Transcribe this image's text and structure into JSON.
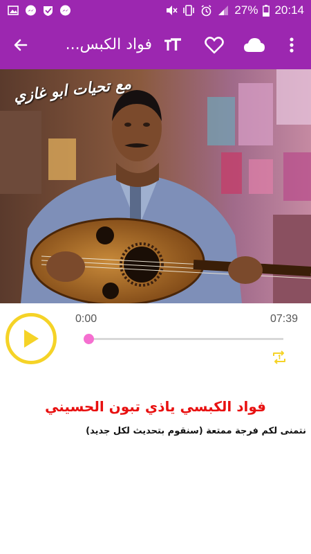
{
  "status_bar": {
    "battery": "27%",
    "time": "20:14",
    "left_icons": [
      "gallery-icon",
      "messenger-icon",
      "vpn-shield-icon",
      "messenger-icon"
    ],
    "right_icons": [
      "mute-icon",
      "vibrate-icon",
      "alarm-icon",
      "signal-icon"
    ]
  },
  "toolbar": {
    "title": "فواد الكبس...",
    "background": "#9c27b0",
    "icons": [
      "back-arrow-icon",
      "text-size-icon",
      "heart-icon",
      "cloud-icon",
      "more-vert-icon"
    ]
  },
  "cover": {
    "caption": "مع تحيات ابو غازي"
  },
  "player": {
    "elapsed": "0:00",
    "duration": "07:39",
    "progress": 0.0,
    "accent": "#f5d327",
    "seek_color": "#f56fd0"
  },
  "song": {
    "title": "فواد الكبسي ياذي تبون الحسيني",
    "description": "نتمنى لكم فرجة ممتعة (سنقوم بتحديث لكل جديد)",
    "title_color": "#e81010"
  }
}
